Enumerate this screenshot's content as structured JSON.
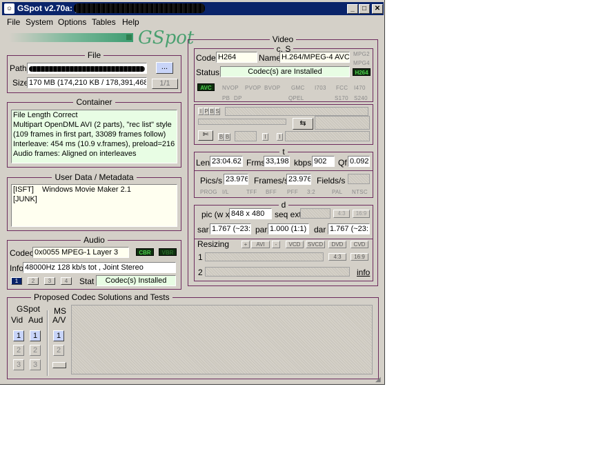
{
  "window": {
    "title": "GSpot v2.70a: [",
    "menu": [
      "File",
      "System",
      "Options",
      "Tables",
      "Help"
    ],
    "logo": "GSpot"
  },
  "file": {
    "title": "File",
    "path_label": "Path",
    "browse_label": "...",
    "size_label": "Size",
    "size_value": "170 MB (174,210 KB / 178,391,468",
    "part_value": "1/1"
  },
  "container": {
    "title": "Container",
    "lines": [
      "File Length Correct",
      "Multipart OpenDML AVI (2 parts), \"rec list\" style",
      "(109 frames in first part, 33089 frames follow)",
      "Interleave: 454 ms (10.9 v.frames), preload=216",
      "Audio frames: Aligned on interleaves"
    ]
  },
  "userdata": {
    "title": "User Data / Metadata",
    "rows": [
      {
        "key": "[ISFT]",
        "value": "Windows Movie Maker 2.1"
      },
      {
        "key": "[JUNK]",
        "value": ""
      }
    ]
  },
  "audio": {
    "title": "Audio",
    "codec_label": "Codec",
    "codec_value": "0x0055  MPEG-1 Layer 3",
    "cbr": "CBR",
    "vbr": "VBR",
    "info_label": "Info",
    "info_value": "48000Hz  128 kb/s tot , Joint Stereo",
    "stream_buttons": [
      "1",
      "2",
      "3",
      "4"
    ],
    "stat_label": "Stat",
    "stat_value": "Codec(s) Installed"
  },
  "video": {
    "title": "Video",
    "cs_title": "c, S",
    "codec_label": "Codec",
    "codec_value": "H264",
    "name_label": "Name",
    "name_value": "H.264/MPEG-4 AVC",
    "mpg2": "MPG2",
    "mpg4": "MPG4",
    "status_label": "Status",
    "status_value": "Codec(s) are Installed",
    "h264": "H264",
    "flags": {
      "avc": "AVC",
      "nvop": "NVOP",
      "pvop": "PVOP",
      "bvop": "BVOP",
      "gmc": "GMC",
      "i703": "I703",
      "fcc": "FCC",
      "i470": "I470",
      "pb": "PB",
      "dp": "DP",
      "qpel": "QPEL",
      "s170": "S170",
      "s240": "S240"
    },
    "ipbs": [
      "I",
      "P",
      "B",
      "S"
    ],
    "bb": [
      "B",
      "B"
    ],
    "ii": [
      "I",
      "I"
    ],
    "t_title": "t",
    "len_label": "Len",
    "len_value": "23:04.62",
    "frms_label": "Frms",
    "frms_value": "33,198",
    "kbps_label": "kbps",
    "kbps_value": "902",
    "qf_label": "Qf",
    "qf_value": "0.092",
    "pics_label": "Pics/s",
    "pics_value": "23.976",
    "frames_label": "Frames/s",
    "frames_value": "23.976",
    "fields_label": "Fields/s",
    "scan_tags": [
      "PROG",
      "I/L",
      "TFF",
      "BFF",
      "PFF",
      "3:2",
      "PAL",
      "NTSC"
    ],
    "d_title": "d",
    "pic_label": "pic (w x",
    "pic_value": "848 x 480",
    "seqext_label": "seq ext",
    "ar43": "4:3",
    "ar169": "16:9",
    "sar_label": "sar",
    "sar_value": "1.767 (~23:",
    "par_label": "par",
    "par_value": "1.000 (1:1)",
    "dar_label": "dar",
    "dar_value": "1.767 (~23:",
    "resizing_label": "Resizing",
    "resize_tags": [
      "+",
      "AVI",
      "-",
      "VCD",
      "SVCD",
      "DVD",
      "CVD"
    ],
    "row1": "1",
    "row2": "2",
    "r_ar43": "4:3",
    "r_ar169": "16:9",
    "info_link": "info"
  },
  "proposed": {
    "title": "Proposed Codec Solutions and Tests",
    "gspot_label": "GSpot",
    "vid_label": "Vid",
    "aud_label": "Aud",
    "ms_label": "MS",
    "av_label": "A/V",
    "buttons": [
      "1",
      "2",
      "3"
    ]
  }
}
